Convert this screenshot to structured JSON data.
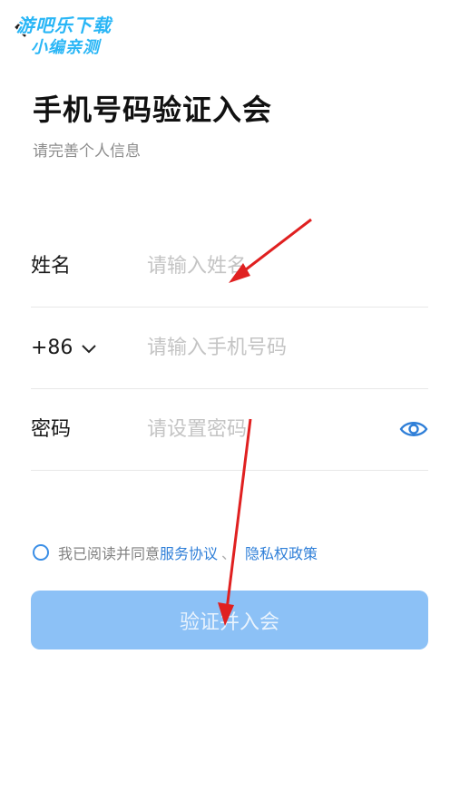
{
  "watermark": {
    "line1": "游吧乐下载",
    "line2": "小编亲测"
  },
  "header": {
    "title": "手机号码验证入会",
    "subtitle": "请完善个人信息"
  },
  "form": {
    "name": {
      "label": "姓名",
      "placeholder": "请输入姓名"
    },
    "phone": {
      "country_code": "+86",
      "placeholder": "请输入手机号码"
    },
    "password": {
      "label": "密码",
      "placeholder": "请设置密码"
    }
  },
  "agreement": {
    "text": "我已阅读并同意",
    "service_link": "服务协议",
    "separator": "、",
    "privacy_link": "隐私权政策"
  },
  "submit_label": "验证并入会",
  "colors": {
    "accent": "#2f7fd8",
    "button_bg": "#8cc1f6",
    "annotation_arrow": "#e02020"
  },
  "icons": [
    "back-arrow-icon",
    "chevron-down-icon",
    "eye-icon",
    "radio-circle-icon"
  ]
}
